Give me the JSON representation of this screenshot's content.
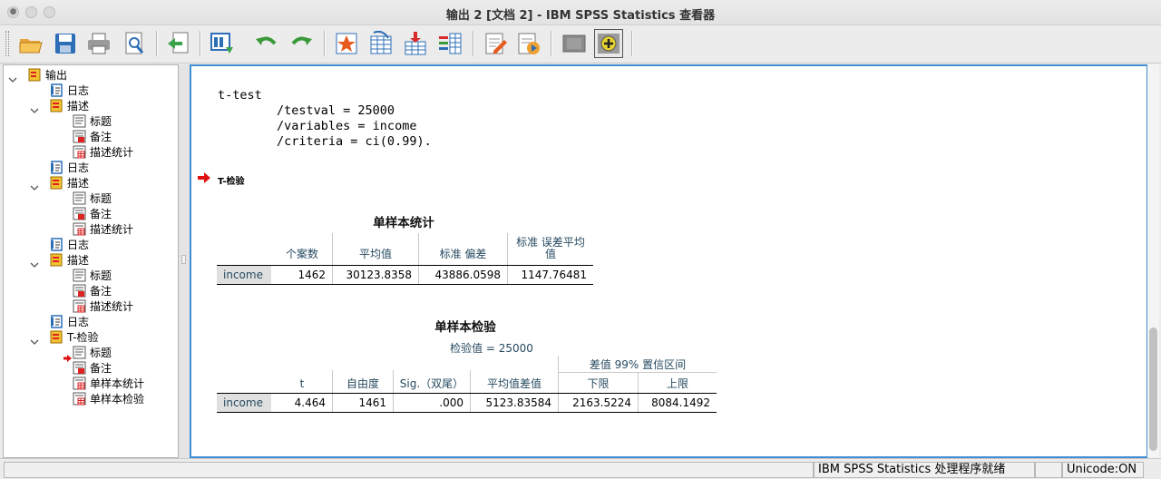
{
  "window": {
    "title": "输出 2 [文档 2] - IBM SPSS Statistics 查看器"
  },
  "toolbar": {
    "buttons": [
      "open-icon",
      "save-icon",
      "print-icon",
      "print-preview-icon",
      "export-icon",
      "goto-data-icon",
      "undo-icon",
      "redo-icon",
      "goto-case-icon",
      "goto-variable-icon",
      "insert-cases-icon",
      "variables-icon",
      "edit-icon",
      "script-icon",
      "designate-icon",
      "add-icon"
    ]
  },
  "tree": {
    "items": [
      {
        "label": "输出",
        "level": 0,
        "icon": "output-book-icon"
      },
      {
        "label": "日志",
        "level": 1,
        "icon": "log-icon"
      },
      {
        "label": "描述",
        "level": 1,
        "icon": "procedure-icon"
      },
      {
        "label": "标题",
        "level": 2,
        "icon": "title-icon"
      },
      {
        "label": "备注",
        "level": 2,
        "icon": "notes-icon"
      },
      {
        "label": "描述统计",
        "level": 2,
        "icon": "table-icon"
      },
      {
        "label": "日志",
        "level": 1,
        "icon": "log-icon"
      },
      {
        "label": "描述",
        "level": 1,
        "icon": "procedure-icon"
      },
      {
        "label": "标题",
        "level": 2,
        "icon": "title-icon"
      },
      {
        "label": "备注",
        "level": 2,
        "icon": "notes-icon"
      },
      {
        "label": "描述统计",
        "level": 2,
        "icon": "table-icon"
      },
      {
        "label": "日志",
        "level": 1,
        "icon": "log-icon"
      },
      {
        "label": "描述",
        "level": 1,
        "icon": "procedure-icon"
      },
      {
        "label": "标题",
        "level": 2,
        "icon": "title-icon"
      },
      {
        "label": "备注",
        "level": 2,
        "icon": "notes-icon"
      },
      {
        "label": "描述统计",
        "level": 2,
        "icon": "table-icon"
      },
      {
        "label": "日志",
        "level": 1,
        "icon": "log-icon"
      },
      {
        "label": "T-检验",
        "level": 1,
        "icon": "procedure-icon"
      },
      {
        "label": "标题",
        "level": 2,
        "icon": "title-icon"
      },
      {
        "label": "备注",
        "level": 2,
        "icon": "notes-icon"
      },
      {
        "label": "单样本统计",
        "level": 2,
        "icon": "table-icon"
      },
      {
        "label": "单样本检验",
        "level": 2,
        "icon": "table-icon"
      }
    ]
  },
  "output": {
    "syntax": "t-test\n        /testval = 25000\n        /variables = income\n        /criteria = ci(0.99).",
    "heading": "T-检验",
    "stats_table": {
      "title": "单样本统计",
      "headers": [
        "个案数",
        "平均值",
        "标准 偏差",
        "标准 误差平均\n值"
      ],
      "row_label": "income",
      "values": [
        "1462",
        "30123.8358",
        "43886.0598",
        "1147.76481"
      ]
    },
    "test_table": {
      "title": "单样本检验",
      "subtitle": "检验值 = 25000",
      "ci_header": "差值 99% 置信区间",
      "headers": [
        "t",
        "自由度",
        "Sig.（双尾）",
        "平均值差值",
        "下限",
        "上限"
      ],
      "row_label": "income",
      "values": [
        "4.464",
        "1461",
        ".000",
        "5123.83584",
        "2163.5224",
        "8084.1492"
      ]
    }
  },
  "status": {
    "processor": "IBM SPSS Statistics 处理程序就绪",
    "unicode": "Unicode:ON"
  }
}
